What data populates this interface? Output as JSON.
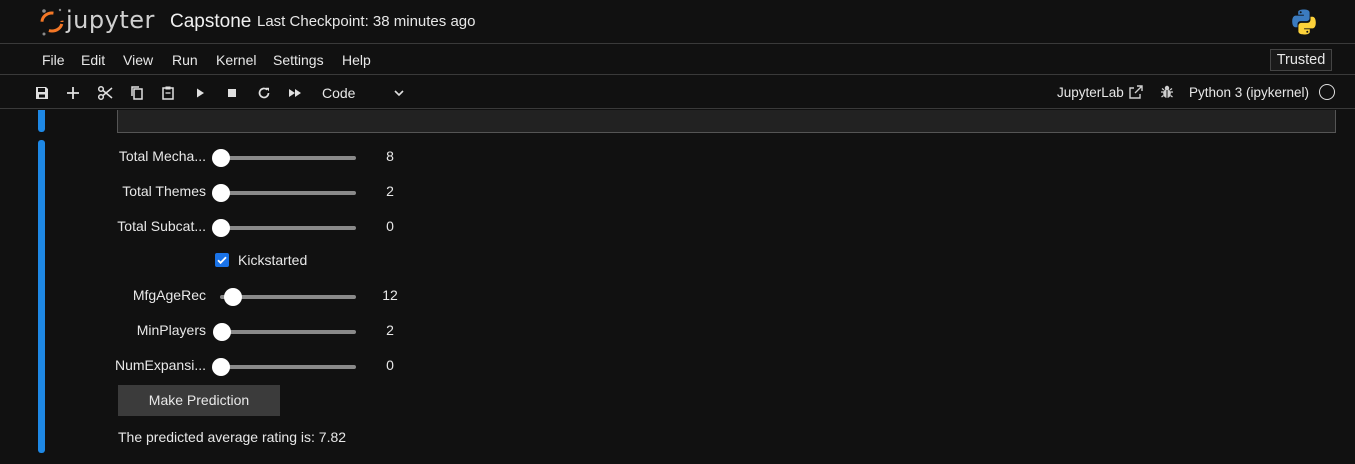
{
  "header": {
    "logo_text": "jupyter",
    "notebook_title": "Capstone",
    "checkpoint": "Last Checkpoint: 38 minutes ago"
  },
  "menu": {
    "items": [
      "File",
      "Edit",
      "View",
      "Run",
      "Kernel",
      "Settings",
      "Help"
    ],
    "trusted": "Trusted"
  },
  "toolbar": {
    "icons": [
      "save-icon",
      "add-cell-icon",
      "cut-icon",
      "copy-icon",
      "paste-icon",
      "run-icon",
      "stop-icon",
      "restart-icon",
      "fast-forward-icon"
    ],
    "cell_type": "Code",
    "jupyterlab_link": "JupyterLab",
    "kernel": "Python 3 (ipykernel)"
  },
  "widgets": {
    "sliders": [
      {
        "label": "Total Mecha...",
        "value": "8",
        "level": 0.0
      },
      {
        "label": "Total Themes",
        "value": "2",
        "level": 0.0
      },
      {
        "label": "Total Subcat...",
        "value": "0",
        "level": 0.0
      },
      {
        "label": "MfgAgeRec",
        "value": "12",
        "level": 0.09
      },
      {
        "label": "MinPlayers",
        "value": "2",
        "level": 0.01
      },
      {
        "label": "NumExpansi...",
        "value": "0",
        "level": 0.0
      }
    ],
    "checkbox": {
      "label": "Kickstarted",
      "checked": true
    },
    "button_label": "Make Prediction",
    "output": "The predicted average rating is: 7.82"
  },
  "colors": {
    "accent": "#1e88e5",
    "background": "#111111",
    "checkbox": "#1a73e8"
  }
}
